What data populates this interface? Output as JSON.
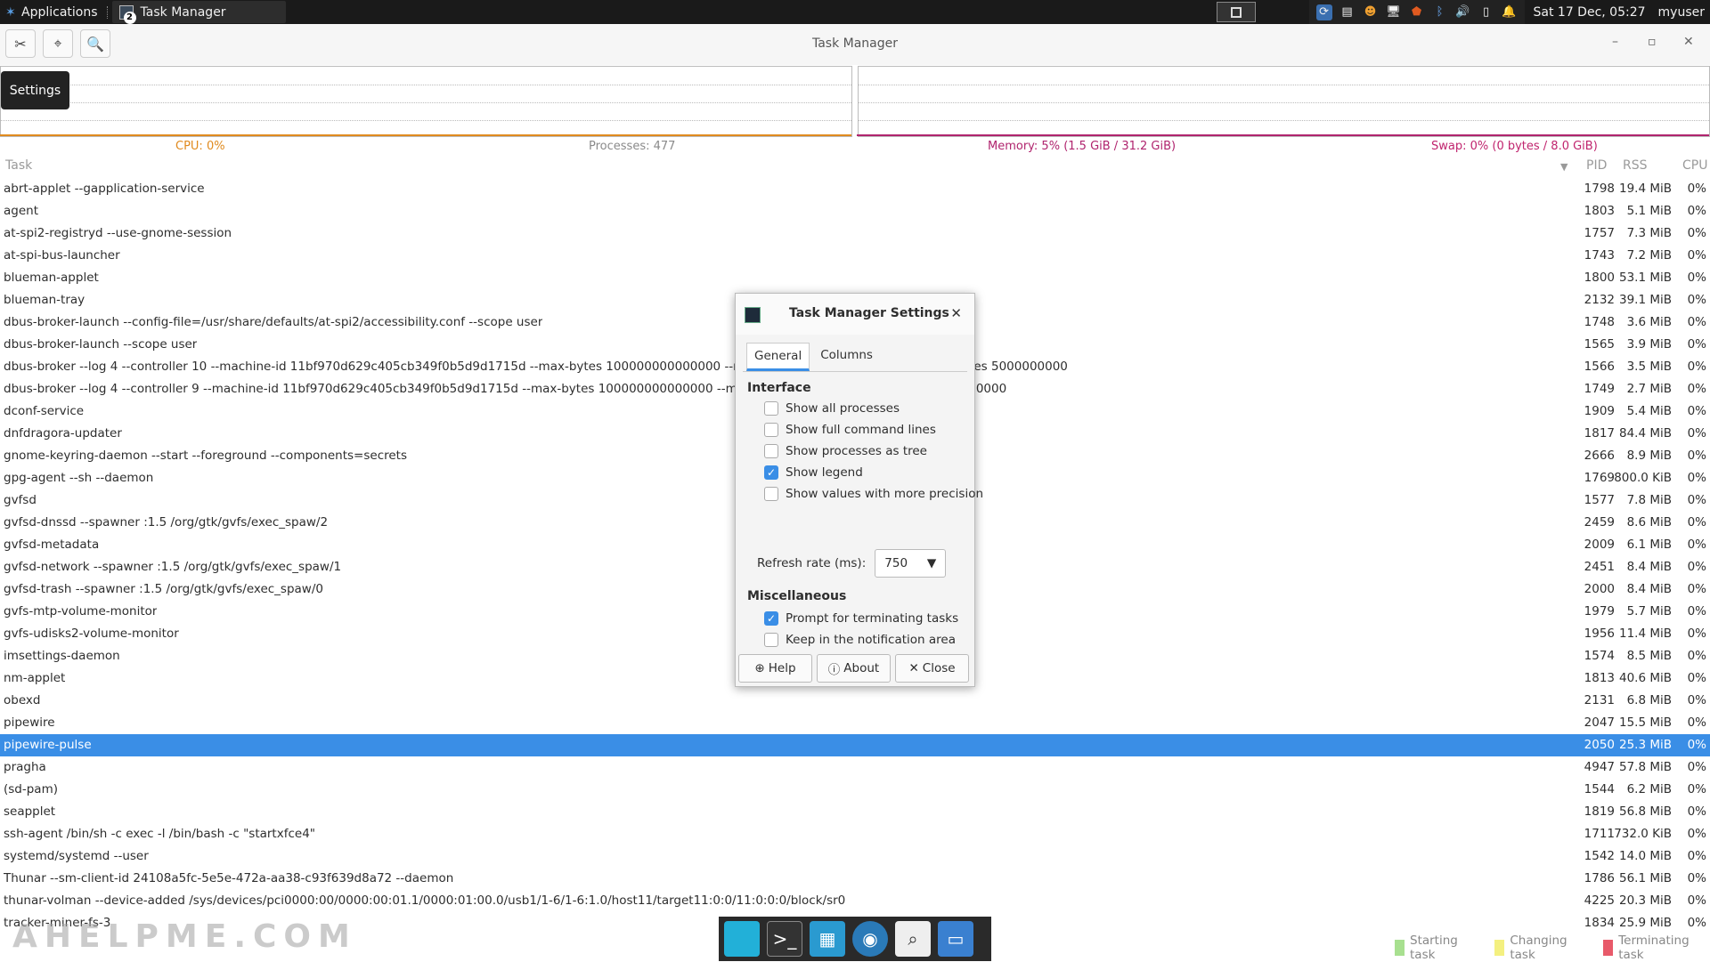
{
  "panel": {
    "applications": "Applications",
    "task_title": "Task Manager",
    "task_badge": "2",
    "datetime": "Sat 17 Dec, 05:27",
    "user": "myuser"
  },
  "window": {
    "title": "Task Manager",
    "tooltip": "Settings",
    "min": "–",
    "max": "▫",
    "close": "✕"
  },
  "legend": {
    "cpu": "CPU: 0%",
    "processes": "Processes: 477",
    "memory": "Memory: 5% (1.5 GiB / 31.2 GiB)",
    "swap": "Swap: 0% (0 bytes / 8.0 GiB)",
    "cpu_color": "#e08a1e",
    "memory_color": "#b0246e",
    "swap_color": "#c0246e"
  },
  "table": {
    "headers": {
      "task": "Task",
      "pid": "PID",
      "rss": "RSS",
      "cpu": "CPU"
    },
    "rows": [
      {
        "task": "abrt-applet --gapplication-service",
        "pid": "1798",
        "rss": "19.4 MiB",
        "cpu": "0%"
      },
      {
        "task": "agent",
        "pid": "1803",
        "rss": "5.1 MiB",
        "cpu": "0%"
      },
      {
        "task": "at-spi2-registryd --use-gnome-session",
        "pid": "1757",
        "rss": "7.3 MiB",
        "cpu": "0%"
      },
      {
        "task": "at-spi-bus-launcher",
        "pid": "1743",
        "rss": "7.2 MiB",
        "cpu": "0%"
      },
      {
        "task": "blueman-applet",
        "pid": "1800",
        "rss": "53.1 MiB",
        "cpu": "0%"
      },
      {
        "task": "blueman-tray",
        "pid": "2132",
        "rss": "39.1 MiB",
        "cpu": "0%"
      },
      {
        "task": "dbus-broker-launch --config-file=/usr/share/defaults/at-spi2/accessibility.conf --scope user",
        "pid": "1748",
        "rss": "3.6 MiB",
        "cpu": "0%"
      },
      {
        "task": "dbus-broker-launch --scope user",
        "pid": "1565",
        "rss": "3.9 MiB",
        "cpu": "0%"
      },
      {
        "task": "dbus-broker --log 4 --controller 10 --machine-id 11bf970d629c405cb349f0b5d9d1715d --max-bytes 100000000000000 --max-fds 25000000000000 --max-matches 5000000000",
        "pid": "1566",
        "rss": "3.5 MiB",
        "cpu": "0%"
      },
      {
        "task": "dbus-broker --log 4 --controller 9 --machine-id 11bf970d629c405cb349f0b5d9d1715d --max-bytes 100000000000000 --max-fds 6400000 --max-matches 5000000000",
        "pid": "1749",
        "rss": "2.7 MiB",
        "cpu": "0%"
      },
      {
        "task": "dconf-service",
        "pid": "1909",
        "rss": "5.4 MiB",
        "cpu": "0%"
      },
      {
        "task": "dnfdragora-updater",
        "pid": "1817",
        "rss": "84.4 MiB",
        "cpu": "0%"
      },
      {
        "task": "gnome-keyring-daemon --start --foreground --components=secrets",
        "pid": "2666",
        "rss": "8.9 MiB",
        "cpu": "0%"
      },
      {
        "task": "gpg-agent --sh --daemon",
        "pid": "1769",
        "rss": "800.0 KiB",
        "cpu": "0%"
      },
      {
        "task": "gvfsd",
        "pid": "1577",
        "rss": "7.8 MiB",
        "cpu": "0%"
      },
      {
        "task": "gvfsd-dnssd --spawner :1.5 /org/gtk/gvfs/exec_spaw/2",
        "pid": "2459",
        "rss": "8.6 MiB",
        "cpu": "0%"
      },
      {
        "task": "gvfsd-metadata",
        "pid": "2009",
        "rss": "6.1 MiB",
        "cpu": "0%"
      },
      {
        "task": "gvfsd-network --spawner :1.5 /org/gtk/gvfs/exec_spaw/1",
        "pid": "2451",
        "rss": "8.4 MiB",
        "cpu": "0%"
      },
      {
        "task": "gvfsd-trash --spawner :1.5 /org/gtk/gvfs/exec_spaw/0",
        "pid": "2000",
        "rss": "8.4 MiB",
        "cpu": "0%"
      },
      {
        "task": "gvfs-mtp-volume-monitor",
        "pid": "1979",
        "rss": "5.7 MiB",
        "cpu": "0%"
      },
      {
        "task": "gvfs-udisks2-volume-monitor",
        "pid": "1956",
        "rss": "11.4 MiB",
        "cpu": "0%"
      },
      {
        "task": "imsettings-daemon",
        "pid": "1574",
        "rss": "8.5 MiB",
        "cpu": "0%"
      },
      {
        "task": "nm-applet",
        "pid": "1813",
        "rss": "40.6 MiB",
        "cpu": "0%"
      },
      {
        "task": "obexd",
        "pid": "2131",
        "rss": "6.8 MiB",
        "cpu": "0%"
      },
      {
        "task": "pipewire",
        "pid": "2047",
        "rss": "15.5 MiB",
        "cpu": "0%"
      },
      {
        "task": "pipewire-pulse",
        "pid": "2050",
        "rss": "25.3 MiB",
        "cpu": "0%",
        "selected": true
      },
      {
        "task": "pragha",
        "pid": "4947",
        "rss": "57.8 MiB",
        "cpu": "0%"
      },
      {
        "task": "(sd-pam)",
        "pid": "1544",
        "rss": "6.2 MiB",
        "cpu": "0%"
      },
      {
        "task": "seapplet",
        "pid": "1819",
        "rss": "56.8 MiB",
        "cpu": "0%"
      },
      {
        "task": "ssh-agent /bin/sh -c exec -l /bin/bash -c \"startxfce4\"",
        "pid": "1711",
        "rss": "732.0 KiB",
        "cpu": "0%"
      },
      {
        "task": "systemd/systemd --user",
        "pid": "1542",
        "rss": "14.0 MiB",
        "cpu": "0%"
      },
      {
        "task": "Thunar --sm-client-id 24108a5fc-5e5e-472a-aa38-c93f639d8a72 --daemon",
        "pid": "1786",
        "rss": "56.1 MiB",
        "cpu": "0%"
      },
      {
        "task": "thunar-volman --device-added /sys/devices/pci0000:00/0000:00:01.1/0000:01:00.0/usb1/1-6/1-6:1.0/host11/target11:0:0/11:0:0:0/block/sr0",
        "pid": "4225",
        "rss": "20.3 MiB",
        "cpu": "0%"
      },
      {
        "task": "tracker-miner-fs-3",
        "pid": "1834",
        "rss": "25.9 MiB",
        "cpu": "0%"
      }
    ]
  },
  "dialog": {
    "title": "Task Manager Settings",
    "tabs": [
      "General",
      "Columns"
    ],
    "interface_heading": "Interface",
    "options": [
      {
        "label": "Show all processes",
        "checked": false
      },
      {
        "label": "Show full command lines",
        "checked": false
      },
      {
        "label": "Show processes as tree",
        "checked": false
      },
      {
        "label": "Show legend",
        "checked": true
      },
      {
        "label": "Show values with more precision",
        "checked": false
      }
    ],
    "refresh_label": "Refresh rate (ms):",
    "refresh_value": "750",
    "misc_heading": "Miscellaneous",
    "misc_options": [
      {
        "label": "Prompt for terminating tasks",
        "checked": true
      },
      {
        "label": "Keep in the notification area",
        "checked": false
      }
    ],
    "buttons": {
      "help": "Help",
      "about": "About",
      "close": "Close"
    }
  },
  "status_legend": {
    "starting": "Starting task",
    "changing": "Changing task",
    "terminating": "Terminating task",
    "starting_color": "#a8e090",
    "changing_color": "#f4f080",
    "terminating_color": "#e85a6a"
  },
  "watermark": "AHELPME.COM"
}
